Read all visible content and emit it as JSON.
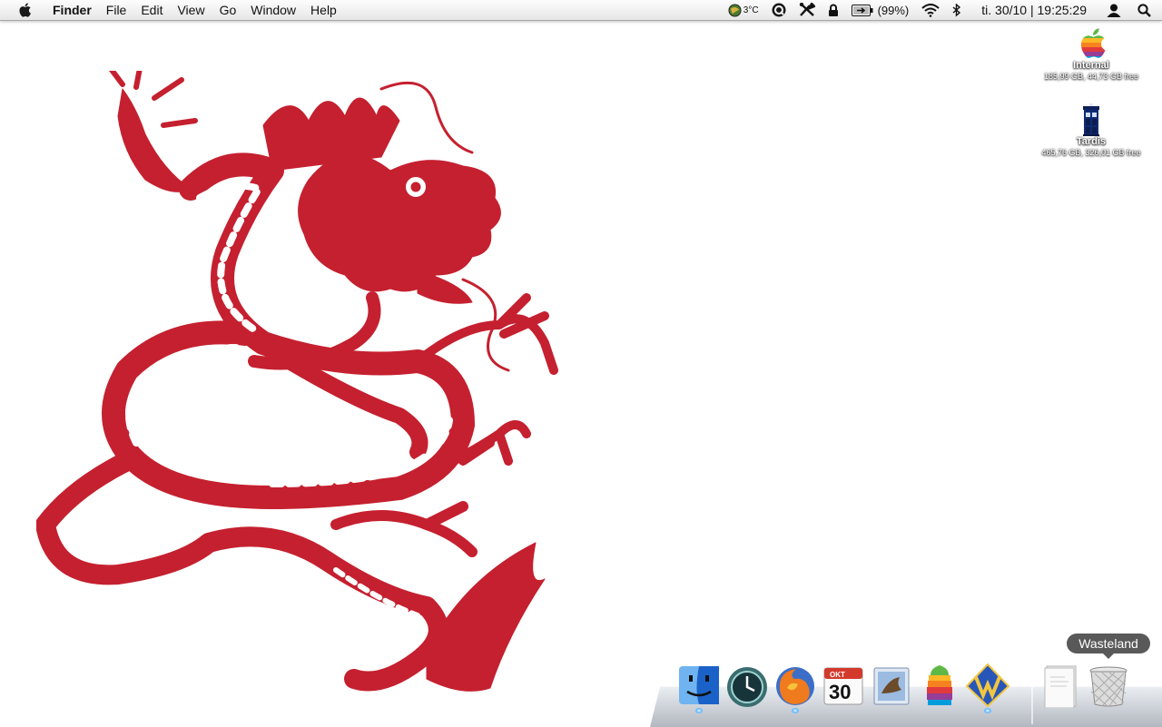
{
  "menubar": {
    "app_name": "Finder",
    "items": [
      "File",
      "Edit",
      "View",
      "Go",
      "Window",
      "Help"
    ],
    "status": {
      "weather_temp": "3°C",
      "battery_percent": "(99%)",
      "clock": "ti. 30/10 | 19:25:29"
    },
    "icons": [
      "apple-logo-icon",
      "weather-icon",
      "quicksilver-icon",
      "tools-icon",
      "lock-icon",
      "battery-icon",
      "wifi-icon",
      "bluetooth-icon",
      "user-icon",
      "spotlight-icon"
    ]
  },
  "desktop": {
    "volumes": [
      {
        "name": "Internal",
        "info": "185,99 GB, 44,73 GB free",
        "icon": "rainbow-apple-drive-icon"
      },
      {
        "name": "Tardis",
        "info": "465,76 GB, 326,01 GB free",
        "icon": "tardis-drive-icon"
      }
    ],
    "wallpaper_icon": "red-dragon-wallpaper"
  },
  "dock": {
    "items": [
      {
        "icon": "finder-icon",
        "running": true
      },
      {
        "icon": "time-machine-icon",
        "running": false
      },
      {
        "icon": "firefox-icon",
        "running": true
      },
      {
        "icon": "ical-icon",
        "running": false,
        "month": "OKT",
        "day": "30"
      },
      {
        "icon": "mail-icon",
        "running": false
      },
      {
        "icon": "rainbow-app-icon",
        "running": false
      },
      {
        "icon": "wings-app-icon",
        "running": true
      },
      {
        "icon": "document-stack-icon",
        "running": false
      },
      {
        "icon": "trash-icon",
        "running": false
      }
    ],
    "tooltip": "Wasteland"
  },
  "colors": {
    "dragon": "#c5202f"
  }
}
